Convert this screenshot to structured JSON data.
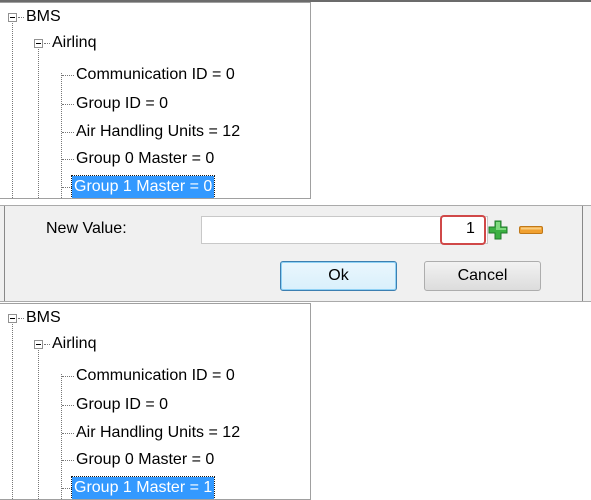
{
  "tree_before": {
    "root_label": "BMS",
    "child_label": "Airlinq",
    "items": [
      "Communication ID = 0",
      "Group ID = 0",
      "Air Handling Units = 12",
      "Group 0 Master  = 0",
      "Group 1 Master = 0"
    ]
  },
  "dialog": {
    "label": "New Value:",
    "value": "1",
    "ok_label": "Ok",
    "cancel_label": "Cancel",
    "highlight_color": "#d04848"
  },
  "tree_after": {
    "root_label": "BMS",
    "child_label": "Airlinq",
    "items": [
      "Communication ID = 0",
      "Group ID = 0",
      "Air Handling Units = 12",
      "Group 0 Master  = 0",
      "Group 1 Master  = 1"
    ]
  },
  "colors": {
    "selection": "#3399ff",
    "plus_icon": "#3cb043",
    "minus_icon": "#f0a030"
  },
  "icons": [
    "expander-icon",
    "plus-icon",
    "minus-icon"
  ]
}
